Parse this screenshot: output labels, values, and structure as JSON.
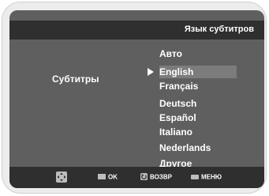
{
  "menu": {
    "title": "Язык субтитров",
    "label": "Субтитры",
    "options": [
      "Авто",
      "English",
      "Français",
      "Deutsch",
      "Español",
      "Italiano",
      "Nederlands",
      "Другое"
    ],
    "selected_index": 1
  },
  "footer": {
    "ok_label": "OK",
    "return_label": "ВОЗВР",
    "menu_label": "МЕНЮ"
  },
  "icons": {
    "dpad": "dpad-icon",
    "ok": "enter-icon",
    "return": "return-icon",
    "menu": "menu-icon",
    "selector": "play-arrow-icon"
  }
}
